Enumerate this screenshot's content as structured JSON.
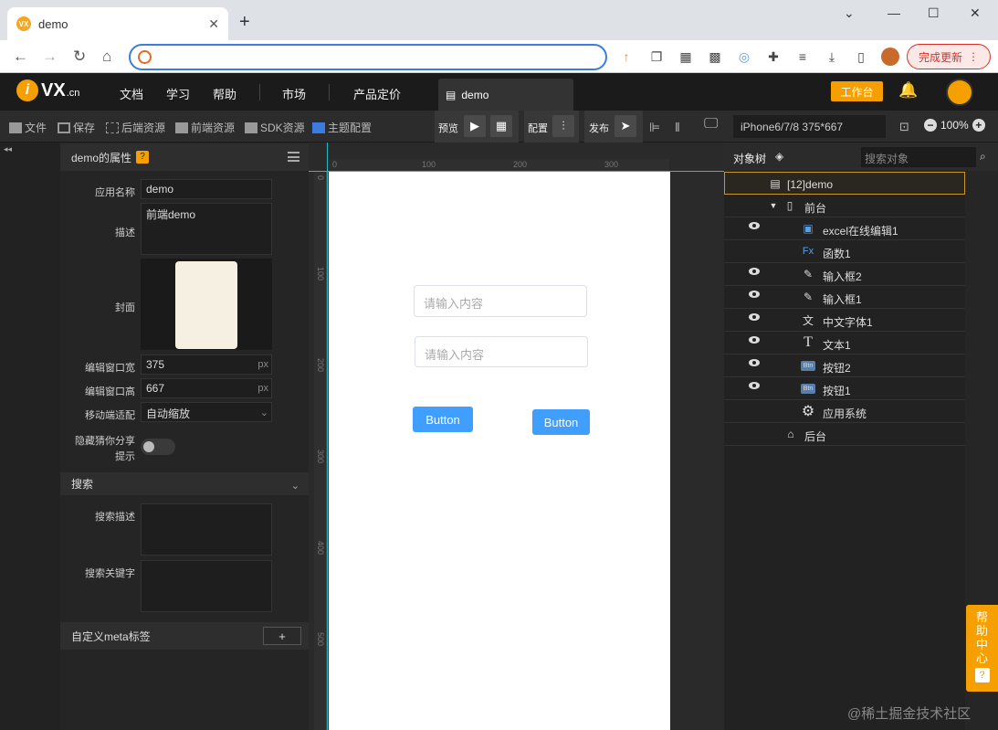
{
  "browser": {
    "tab_title": "demo",
    "favicon_text": "VX",
    "update_label": "完成更新"
  },
  "appnav": {
    "logo_i": "i",
    "logo_vx": "VX",
    "logo_cn": ".cn",
    "items": [
      "文档",
      "学习",
      "帮助",
      "市场",
      "产品定价"
    ],
    "tab_label": "demo",
    "workbench_label": "工作台"
  },
  "toolbar": {
    "file": "文件",
    "save": "保存",
    "backend_res": "后端资源",
    "frontend_res": "前端资源",
    "sdk_res": "SDK资源",
    "theme": "主题配置",
    "preview": "预览",
    "config": "配置",
    "publish": "发布",
    "device": "iPhone6/7/8 375*667",
    "zoom": "100%"
  },
  "props": {
    "title": "demo的属性",
    "name_label": "应用名称",
    "name_value": "demo",
    "desc_label": "描述",
    "desc_value": "前端demo",
    "cover_label": "封面",
    "width_label": "编辑窗口宽",
    "width_value": "375",
    "height_label": "编辑窗口高",
    "height_value": "667",
    "unit": "px",
    "mobile_label": "移动端适配",
    "mobile_value": "自动缩放",
    "share_label_1": "隐藏猜你分享",
    "share_label_2": "提示",
    "search_section": "搜索",
    "search_desc_label": "搜索描述",
    "search_kw_label": "搜索关键字",
    "meta_section": "自定义meta标签",
    "add_label": "+"
  },
  "canvas": {
    "ruler_x": [
      "0",
      "100",
      "200",
      "300"
    ],
    "ruler_y": [
      "0",
      "100",
      "200",
      "300",
      "400",
      "500"
    ],
    "input1_placeholder": "请输入内容",
    "input2_placeholder": "请输入内容",
    "button1": "Button",
    "button2": "Button"
  },
  "objtree": {
    "title": "对象树",
    "search_placeholder": "搜索对象",
    "rows": [
      {
        "label": "[12]demo",
        "icon": "page-icon"
      },
      {
        "label": "前台",
        "icon": "phone-icon"
      },
      {
        "label": "excel在线编辑1",
        "icon": "excel-icon"
      },
      {
        "label": "函数1",
        "icon": "function-icon"
      },
      {
        "label": "输入框2",
        "icon": "edit-icon"
      },
      {
        "label": "输入框1",
        "icon": "edit-icon"
      },
      {
        "label": "中文字体1",
        "icon": "translate-icon"
      },
      {
        "label": "文本1",
        "icon": "text-icon"
      },
      {
        "label": "按钮2",
        "icon": "button-icon"
      },
      {
        "label": "按钮1",
        "icon": "button-icon"
      },
      {
        "label": "应用系统",
        "icon": "gear-icon"
      },
      {
        "label": "后台",
        "icon": "server-icon"
      }
    ]
  },
  "help": {
    "label": "帮助中心",
    "q": "?"
  },
  "watermark": "@稀土掘金技术社区",
  "colors": {
    "accent": "#f5a000",
    "selection": "#c9952d",
    "button_blue": "#409eff",
    "guide": "#2ab8c8"
  }
}
